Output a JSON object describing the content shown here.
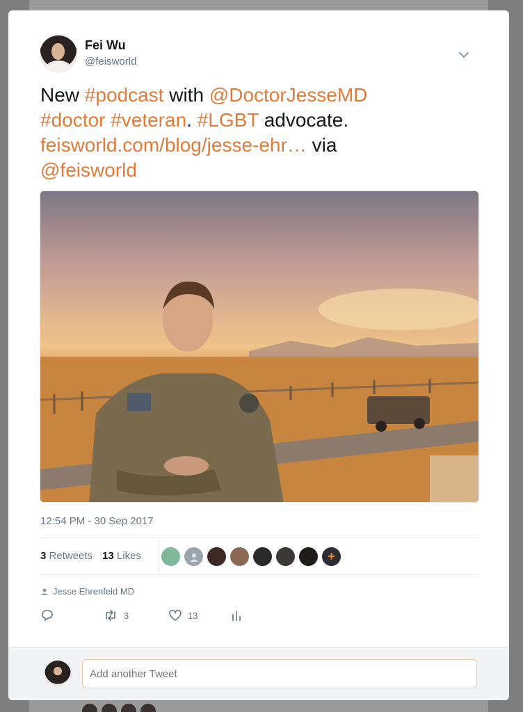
{
  "tweet": {
    "author_name": "Fei Wu",
    "author_handle": "@feisworld",
    "text": {
      "w1": "New ",
      "l1": "#podcast",
      "w2": " with ",
      "l2": "@DoctorJesseMD",
      "l3": "#doctor",
      "w3": " ",
      "l4": "#veteran",
      "w4": ". ",
      "l5": "#LGBT",
      "w5": " advocate.",
      "l6": "feisworld.com/blog/jesse-ehr…",
      "w6": " via",
      "l7": "@feisworld"
    },
    "timestamp": "12:54 PM - 30 Sep 2017",
    "retweet_count": "3",
    "retweets_label": "Retweets",
    "like_count": "13",
    "likes_label": "Likes",
    "likers_more_symbol": "+",
    "context_author": "Jesse Ehrenfeld MD",
    "actions": {
      "retweet_count": "3",
      "like_count": "13"
    }
  },
  "reply": {
    "placeholder": "Add another Tweet"
  },
  "colors": {
    "link": "#e07b39",
    "text": "#14171a",
    "muted": "#657786"
  },
  "icons": [
    "caret-down-icon",
    "user-icon",
    "reply-icon",
    "retweet-icon",
    "heart-icon",
    "analytics-icon",
    "plus-icon"
  ]
}
